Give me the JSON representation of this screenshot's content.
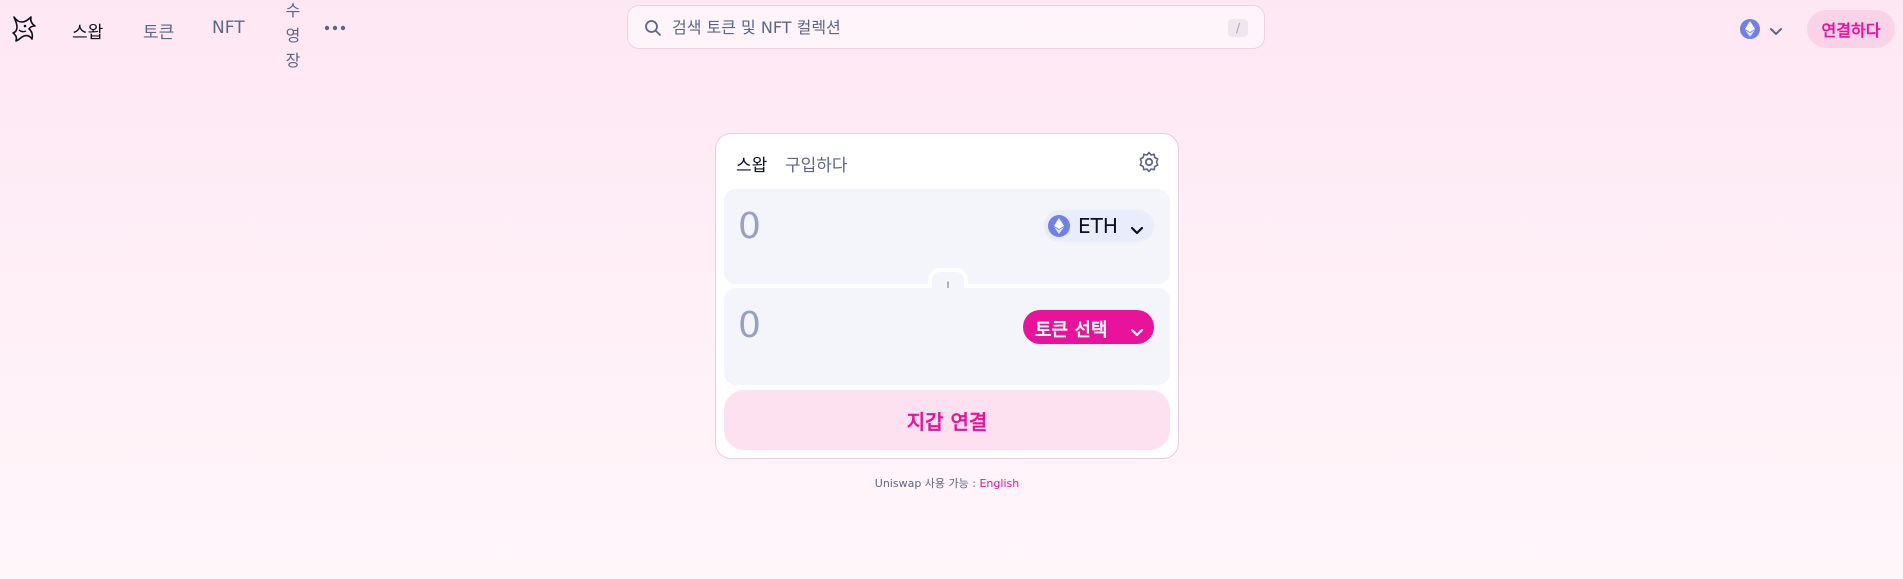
{
  "nav": {
    "items": [
      {
        "label": "스왑",
        "active": true
      },
      {
        "label": "토큰",
        "active": false
      },
      {
        "label": "NFT",
        "active": false
      },
      {
        "label": "수영장",
        "active": false
      }
    ],
    "more_icon": "ellipsis-icon"
  },
  "search": {
    "placeholder": "검색 토큰 및 NFT 컬렉션",
    "shortcut": "/"
  },
  "network": {
    "icon": "ethereum-icon"
  },
  "connect_label": "연결하다",
  "swap": {
    "tabs": [
      "스왑",
      "구입하다"
    ],
    "active_tab": "스왑",
    "sell": {
      "placeholder": "0",
      "token": "ETH"
    },
    "buy": {
      "placeholder": "0",
      "select_label": "토큰 선택"
    },
    "wallet_button": "지갑 연결"
  },
  "footer": {
    "text": "Uniswap 사용 가능 : ",
    "language": "English"
  },
  "colors": {
    "accent": "#e8129b",
    "accent_soft": "#fde1f0",
    "eth": "#6e81e6",
    "muted_text": "#5d6785",
    "panel": "#f4f5fa"
  }
}
